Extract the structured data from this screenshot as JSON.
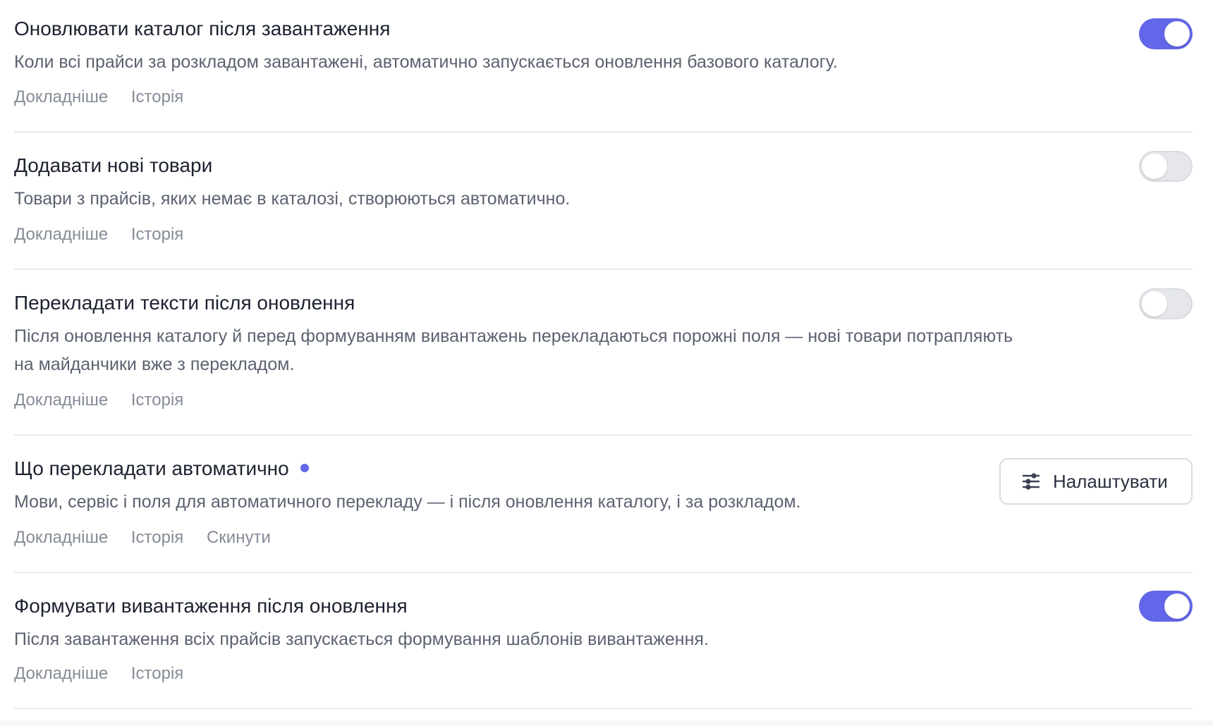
{
  "settings": [
    {
      "title": "Оновлювати каталог після завантаження",
      "description": "Коли всі прайси за розкладом завантажені, автоматично запускається оновлення базового каталогу.",
      "links": [
        "Докладніше",
        "Історія"
      ],
      "control": "toggle",
      "enabled": true
    },
    {
      "title": "Додавати нові товари",
      "description": "Товари з прайсів, яких немає в каталозі, створюються автоматично.",
      "links": [
        "Докладніше",
        "Історія"
      ],
      "control": "toggle",
      "enabled": false
    },
    {
      "title": "Перекладати тексти після оновлення",
      "description": "Після оновлення каталогу й перед формуванням вивантажень перекладаються порожні поля — нові товари потрапляють на майданчики вже з перекладом.",
      "links": [
        "Докладніше",
        "Історія"
      ],
      "control": "toggle",
      "enabled": false
    },
    {
      "title": "Що перекладати автоматично",
      "description": "Мови, сервіс і поля для автоматичного перекладу — і після оновлення каталогу, і за розкладом.",
      "links": [
        "Докладніше",
        "Історія",
        "Скинути"
      ],
      "control": "button",
      "button_label": "Налаштувати",
      "button_icon": "sliders-icon",
      "has_status_dot": true
    },
    {
      "title": "Формувати вивантаження після оновлення",
      "description": "Після завантаження всіх прайсів запускається формування шаблонів вивантаження.",
      "links": [
        "Докладніше",
        "Історія"
      ],
      "control": "toggle",
      "enabled": true
    }
  ],
  "colors": {
    "accent": "#6466e9",
    "title": "#1d2230",
    "description": "#5b6270",
    "link": "#858b97",
    "divider": "#e8eaee",
    "toggle_off": "#e5e7eb"
  }
}
